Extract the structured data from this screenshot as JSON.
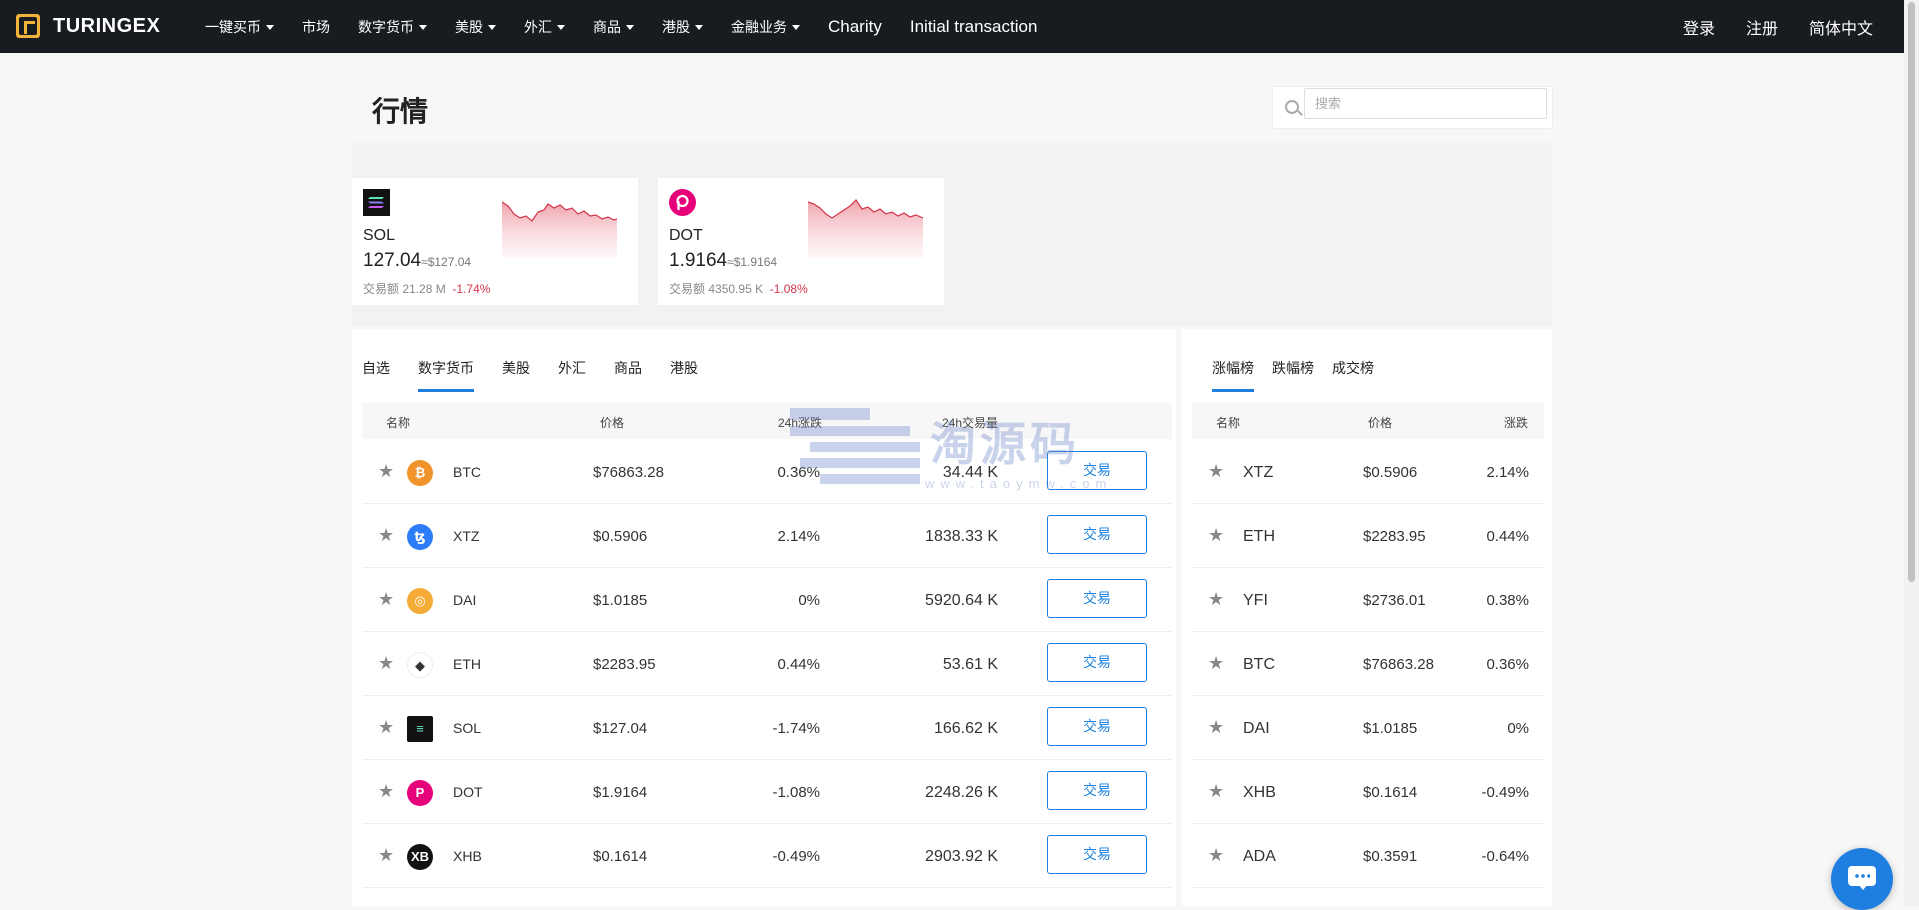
{
  "header": {
    "logo_text": "TURINGEX",
    "nav": [
      {
        "label": "一键买币",
        "dropdown": true
      },
      {
        "label": "市场",
        "dropdown": false
      },
      {
        "label": "数字货币",
        "dropdown": true
      },
      {
        "label": "美股",
        "dropdown": true
      },
      {
        "label": "外汇",
        "dropdown": true
      },
      {
        "label": "商品",
        "dropdown": true
      },
      {
        "label": "港股",
        "dropdown": true
      },
      {
        "label": "金融业务",
        "dropdown": true
      },
      {
        "label": "Charity",
        "dropdown": false
      },
      {
        "label": "Initial transaction",
        "dropdown": false
      }
    ],
    "login": "登录",
    "register": "注册",
    "language": "简体中文"
  },
  "page": {
    "title": "行情",
    "search_placeholder": "搜索"
  },
  "cards": [
    {
      "symbol": "SOL",
      "price": "127.04",
      "price_usd": "≈$127.04",
      "volume_label": "交易额",
      "volume": "21.28 M",
      "change": "-1.74%"
    },
    {
      "symbol": "DOT",
      "price": "1.9164",
      "price_usd": "≈$1.9164",
      "volume_label": "交易额",
      "volume": "4350.95 K",
      "change": "-1.08%"
    }
  ],
  "market": {
    "tabs": [
      "自选",
      "数字货币",
      "美股",
      "外汇",
      "商品",
      "港股"
    ],
    "active_tab": "数字货币",
    "columns": [
      "名称",
      "价格",
      "24h涨跌",
      "24h交易量"
    ],
    "trade_label": "交易",
    "rows": [
      {
        "symbol": "BTC",
        "price": "$76863.28",
        "change": "0.36%",
        "trend": "up",
        "volume": "34.44 K"
      },
      {
        "symbol": "XTZ",
        "price": "$0.5906",
        "change": "2.14%",
        "trend": "up",
        "volume": "1838.33 K"
      },
      {
        "symbol": "DAI",
        "price": "$1.0185",
        "change": "0%",
        "trend": "down",
        "volume": "5920.64 K"
      },
      {
        "symbol": "ETH",
        "price": "$2283.95",
        "change": "0.44%",
        "trend": "up",
        "volume": "53.61 K"
      },
      {
        "symbol": "SOL",
        "price": "$127.04",
        "change": "-1.74%",
        "trend": "down",
        "volume": "166.62 K"
      },
      {
        "symbol": "DOT",
        "price": "$1.9164",
        "change": "-1.08%",
        "trend": "down",
        "volume": "2248.26 K"
      },
      {
        "symbol": "XHB",
        "price": "$0.1614",
        "change": "-0.49%",
        "trend": "down",
        "volume": "2903.92 K"
      }
    ]
  },
  "ranking": {
    "tabs": [
      "涨幅榜",
      "跌幅榜",
      "成交榜"
    ],
    "active_tab": "涨幅榜",
    "columns": [
      "名称",
      "价格",
      "涨跌"
    ],
    "rows": [
      {
        "symbol": "XTZ",
        "price": "$0.5906",
        "change": "2.14%",
        "trend": "up"
      },
      {
        "symbol": "ETH",
        "price": "$2283.95",
        "change": "0.44%",
        "trend": "up"
      },
      {
        "symbol": "YFI",
        "price": "$2736.01",
        "change": "0.38%",
        "trend": "up"
      },
      {
        "symbol": "BTC",
        "price": "$76863.28",
        "change": "0.36%",
        "trend": "up"
      },
      {
        "symbol": "DAI",
        "price": "$1.0185",
        "change": "0%",
        "trend": "down"
      },
      {
        "symbol": "XHB",
        "price": "$0.1614",
        "change": "-0.49%",
        "trend": "down"
      },
      {
        "symbol": "ADA",
        "price": "$0.3591",
        "change": "-0.64%",
        "trend": "down"
      }
    ]
  },
  "watermark": {
    "text": "淘源码",
    "sub": "www.taoymw.com"
  },
  "colors": {
    "up": "#1ba27a",
    "down": "#d6334a",
    "accent": "#1f7fe0",
    "header_bg": "#181c21"
  },
  "icons": {
    "BTC": "bitcoin-icon",
    "XTZ": "tezos-icon",
    "DAI": "dai-icon",
    "ETH": "ethereum-icon",
    "SOL": "solana-icon",
    "DOT": "polkadot-icon",
    "XHB": "xhb-icon"
  }
}
